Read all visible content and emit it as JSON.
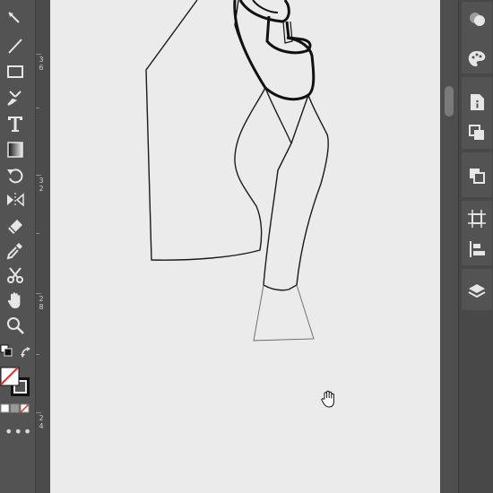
{
  "toolbar": {
    "tools": [
      {
        "name": "curvature-tool-icon"
      },
      {
        "name": "line-segment-tool-icon"
      },
      {
        "name": "rectangle-tool-icon"
      },
      {
        "name": "paintbrush-tool-icon"
      },
      {
        "name": "type-tool-icon"
      },
      {
        "name": "gradient-tool-icon"
      },
      {
        "name": "rotate-tool-icon"
      },
      {
        "name": "reflect-tool-icon"
      },
      {
        "name": "eraser-tool-icon"
      },
      {
        "name": "eyedropper-tool-icon"
      },
      {
        "name": "scissors-tool-icon"
      },
      {
        "name": "hand-tool-icon"
      },
      {
        "name": "zoom-tool-icon"
      }
    ],
    "more_label": "•••"
  },
  "ruler": {
    "labels": [
      "36",
      "32",
      "28",
      "24"
    ]
  },
  "colors": {
    "toolbar_bg": "#535353",
    "canvas_bg": "#ebebeb",
    "stroke": "#111111",
    "fill_none_slash": "#e0312c"
  },
  "right_panel": {
    "icons": [
      "appearance-icon",
      "swatches-icon",
      "document-info-icon",
      "pathfinder-icon",
      "transform-icon",
      "artboards-icon",
      "align-icon",
      "layers-icon"
    ]
  },
  "cursor": "hand-cursor-icon"
}
